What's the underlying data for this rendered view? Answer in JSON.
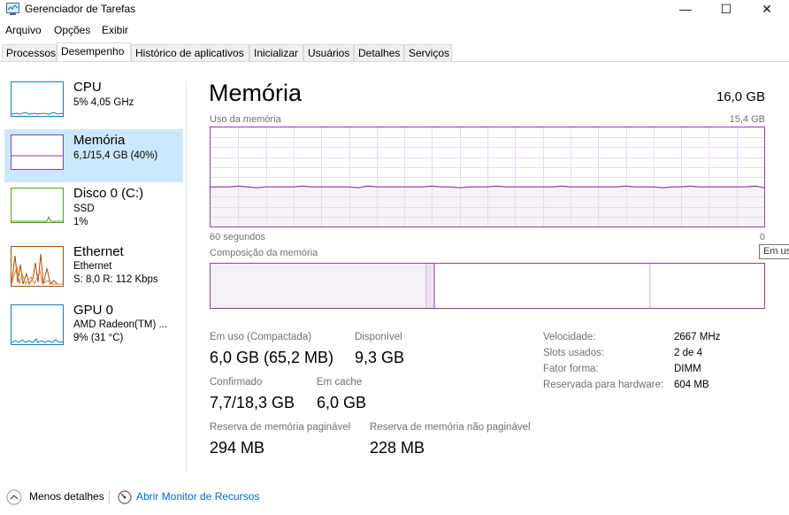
{
  "window": {
    "title": "Gerenciador de Tarefas",
    "minimize": "—",
    "maximize": "☐",
    "close": "✕"
  },
  "menu": [
    "Arquivo",
    "Opções",
    "Exibir"
  ],
  "tabs": [
    "Processos",
    "Desempenho",
    "Histórico de aplicativos",
    "Inicializar",
    "Usuários",
    "Detalhes",
    "Serviços"
  ],
  "active_tab": "Desempenho",
  "sidebar": {
    "items": [
      {
        "title": "CPU",
        "line1": "5%  4,05 GHz",
        "color": "#117dbb",
        "usage": 0.05
      },
      {
        "title": "Memória",
        "line1": "6,1/15,4 GB (40%)",
        "color": "#8b3fa6",
        "usage": 0.4,
        "selected": true
      },
      {
        "title": "Disco 0 (C:)",
        "line1": "SSD",
        "line2": "1%",
        "color": "#4da60c",
        "usage": 0.01
      },
      {
        "title": "Ethernet",
        "line1": "Ethernet",
        "line2": "S: 8,0  R: 112 Kbps",
        "color": "#a74f01"
      },
      {
        "title": "GPU 0",
        "line1": "AMD Radeon(TM) ...",
        "line2": "9% (31 °C)",
        "color": "#117dbb",
        "usage": 0.09
      }
    ]
  },
  "memory": {
    "title": "Memória",
    "total": "16,0 GB",
    "usage_label": "Uso da memória",
    "usage_max": "15,4 GB",
    "time_left": "60 segundos",
    "time_right": "0",
    "composition_label": "Composição da memória",
    "tooltip": "Em us",
    "usage_fraction": 0.4,
    "composition": {
      "in_use_gb": 6.0,
      "modified_gb": 0.2,
      "standby_gb": 6.0,
      "total_gb": 15.4
    },
    "stats": {
      "in_use_label": "Em uso (Compactada)",
      "in_use_value": "6,0 GB (65,2 MB)",
      "available_label": "Disponível",
      "available_value": "9,3 GB",
      "committed_label": "Confirmado",
      "committed_value": "7,7/18,3 GB",
      "cached_label": "Em cache",
      "cached_value": "6,0 GB",
      "paged_label": "Reserva de memória paginável",
      "paged_value": "294 MB",
      "nonpaged_label": "Reserva de memória não paginável",
      "nonpaged_value": "228 MB"
    },
    "specs": [
      {
        "label": "Velocidade:",
        "value": "2667 MHz"
      },
      {
        "label": "Slots usados:",
        "value": "2 de 4"
      },
      {
        "label": "Fator forma:",
        "value": "DIMM"
      },
      {
        "label": "Reservada para hardware:",
        "value": "604 MB"
      }
    ]
  },
  "footer": {
    "less_details": "Menos detalhes",
    "resource_monitor": "Abrir Monitor de Recursos"
  }
}
